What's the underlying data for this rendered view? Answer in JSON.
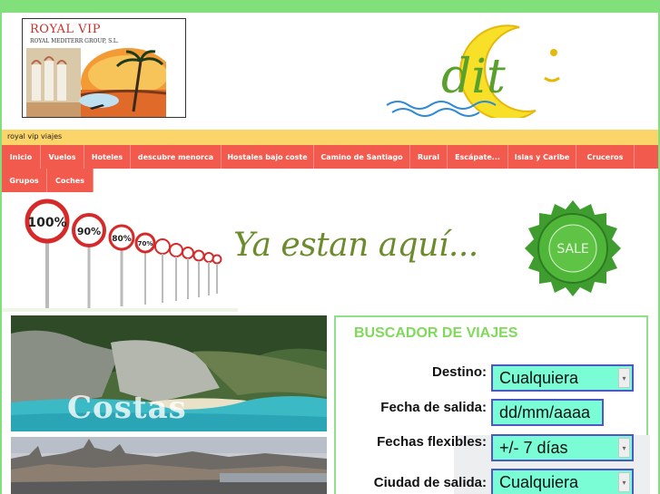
{
  "header": {
    "logo_title": "ROYAL VIP",
    "logo_subtitle": "ROYAL MEDITERR GROUP, S.L.",
    "dit_logo_text": "dit"
  },
  "site_strip": {
    "label": "royal vip viajes"
  },
  "nav": {
    "items": [
      {
        "label": "Inicio"
      },
      {
        "label": "Vuelos"
      },
      {
        "label": "Hoteles"
      },
      {
        "label": "descubre menorca"
      },
      {
        "label": "Hostales bajo coste"
      },
      {
        "label": "Camino de Santiago"
      },
      {
        "label": "Rural"
      },
      {
        "label": "Escápate..."
      },
      {
        "label": "Islas y Caribe"
      },
      {
        "label": "Cruceros"
      },
      {
        "label": "Grupos"
      },
      {
        "label": "Coches"
      }
    ]
  },
  "banner": {
    "tagline": "Ya estan aquí...",
    "signs": [
      "100%",
      "90%",
      "80%",
      "70%"
    ],
    "sale_text": "SALE"
  },
  "promos": {
    "costas_label": "Costas"
  },
  "search": {
    "title": "BUSCADOR DE VIAJES",
    "fields": [
      {
        "label": "Destino:",
        "value": "Cualquiera"
      },
      {
        "label": "Fecha de salida:",
        "value": "dd/mm/aaaa"
      },
      {
        "label": "Fechas flexibles:",
        "value": "+/- 7 días"
      },
      {
        "label": "Ciudad de salida:",
        "value": "Cualquiera"
      }
    ]
  },
  "colors": {
    "page_bg": "#82e07c",
    "nav_bg": "#f35a4e",
    "strip_bg": "#fbd46a",
    "field_bg": "#7afcd4",
    "field_border": "#4d57c8",
    "search_title": "#7fd95a",
    "tagline": "#6c8b2c"
  }
}
